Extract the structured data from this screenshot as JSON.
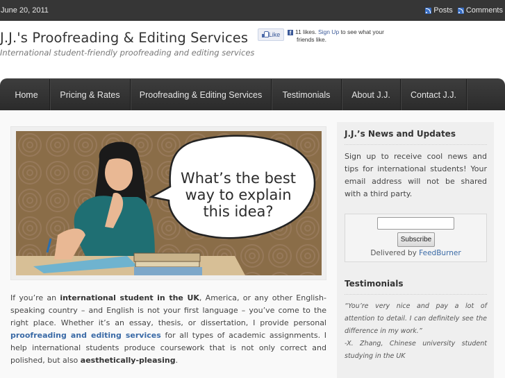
{
  "topbar": {
    "date": "June 20, 2011",
    "feeds": [
      {
        "label": "Posts",
        "icon": "rss-icon"
      },
      {
        "label": "Comments",
        "icon": "rss-icon"
      }
    ]
  },
  "header": {
    "title": "J.J.'s Proofreading & Editing Services",
    "tagline": "International student-friendly proofreading and editing services"
  },
  "facebook": {
    "like_label": "Like",
    "count_text": "11 likes.",
    "signup_label": "Sign Up",
    "rest_text": "to see what your",
    "line2": "friends like."
  },
  "nav": {
    "items": [
      {
        "label": "Home"
      },
      {
        "label": "Pricing & Rates"
      },
      {
        "label": "Proofreading & Editing Services"
      },
      {
        "label": "Testimonials"
      },
      {
        "label": "About J.J."
      },
      {
        "label": "Contact J.J."
      }
    ]
  },
  "hero": {
    "speech_lines": [
      "What’s the best",
      "way to explain",
      "this idea?"
    ],
    "colors": {
      "background": "#8a6d48",
      "shirt": "#1f6f73",
      "hair": "#1a1a1a",
      "skin": "#e9b894",
      "desk": "#d7bf96"
    }
  },
  "intro": {
    "p1": "If you’re an ",
    "b1": "international student in the UK",
    "p2": ", America, or any other English-speaking country – and English is not your first language – you’ve come to the right place. Whether it’s an essay, thesis, or dissertation, I provide personal ",
    "link": "proofreading and editing services",
    "p3": " for all types of academic assignments. I help international students produce coursework that is not only correct and polished, but also ",
    "b2": "aesthetically-pleasing",
    "p4": "."
  },
  "sidebar": {
    "news": {
      "title": "J.J.’s News and Updates",
      "text": "Sign up to receive cool news and tips for international students! Your email address will not be shared with a third party.",
      "email_value": "",
      "subscribe_label": "Subscribe",
      "delivered_prefix": "Delivered by ",
      "delivered_link": "FeedBurner"
    },
    "testimonials": {
      "title": "Testimonials",
      "quote": "“You’re very nice and pay a lot of attention to detail. I can definitely see the difference in my work.”",
      "attribution": "-X. Zhang, Chinese university student studying in the UK"
    }
  },
  "colors": {
    "topbar": "#363636",
    "nav": "#333333",
    "link": "#3a6aa6",
    "sidebar": "#efefef"
  }
}
